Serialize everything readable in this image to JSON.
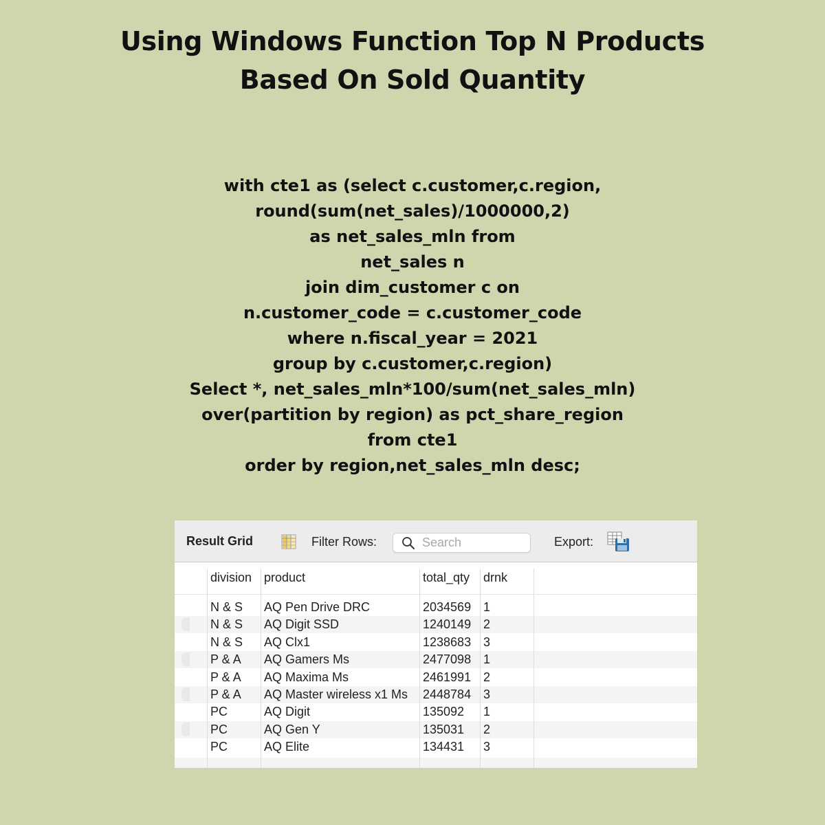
{
  "title": {
    "line1": "Using Windows Function Top N Products",
    "line2": "Based On Sold Quantity"
  },
  "code": [
    "with cte1 as (select c.customer,c.region,",
    "round(sum(net_sales)/1000000,2)",
    "as net_sales_mln from",
    "net_sales n",
    "join dim_customer c on",
    "n.customer_code = c.customer_code",
    "where n.fiscal_year = 2021",
    "group by c.customer,c.region)",
    "Select *, net_sales_mln*100/sum(net_sales_mln)",
    "over(partition by region) as pct_share_region",
    "from cte1",
    "order by region,net_sales_mln desc;"
  ],
  "toolbar": {
    "result_grid_label": "Result Grid",
    "grid_icon": "grid-columns-icon",
    "filter_label": "Filter Rows:",
    "search_placeholder": "Search",
    "search_icon": "search-icon",
    "export_label": "Export:",
    "export_icon": "export-save-icon"
  },
  "table": {
    "columns": [
      "division",
      "product",
      "total_qty",
      "drnk"
    ],
    "rows": [
      [
        "N & S",
        "AQ Pen Drive DRC",
        "2034569",
        "1"
      ],
      [
        "N & S",
        "AQ Digit SSD",
        "1240149",
        "2"
      ],
      [
        "N & S",
        "AQ Clx1",
        "1238683",
        "3"
      ],
      [
        "P & A",
        "AQ Gamers Ms",
        "2477098",
        "1"
      ],
      [
        "P & A",
        "AQ Maxima Ms",
        "2461991",
        "2"
      ],
      [
        "P & A",
        "AQ Master wireless x1 Ms",
        "2448784",
        "3"
      ],
      [
        "PC",
        "AQ Digit",
        "135092",
        "1"
      ],
      [
        "PC",
        "AQ Gen Y",
        "135031",
        "2"
      ],
      [
        "PC",
        "AQ Elite",
        "134431",
        "3"
      ]
    ]
  },
  "colors": {
    "background": "#cfd6ae",
    "toolbar": "#ececec",
    "alt_row": "#f4f4f4"
  }
}
